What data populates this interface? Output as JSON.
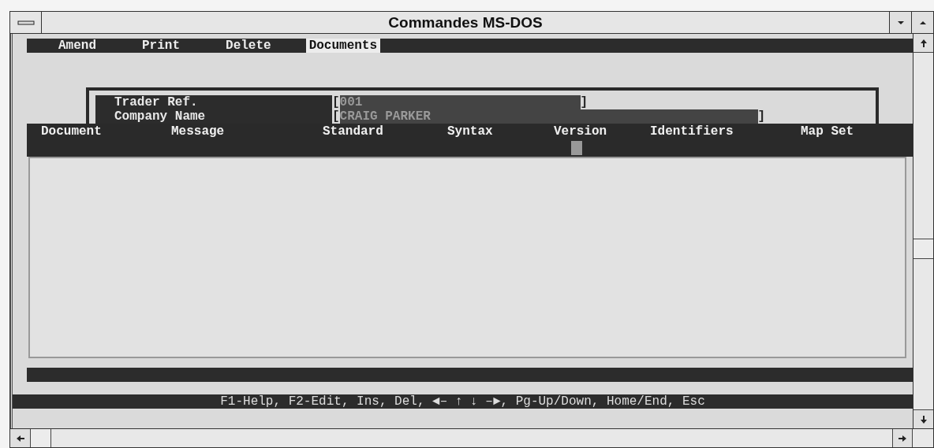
{
  "window": {
    "title": "Commandes MS-DOS"
  },
  "menu": [
    {
      "label": "Amend",
      "selected": false
    },
    {
      "label": "Print",
      "selected": false
    },
    {
      "label": "Delete",
      "selected": false
    },
    {
      "label": "Documents",
      "selected": true
    }
  ],
  "fields": [
    {
      "label": "Trader Ref.",
      "open": "[",
      "value": "001",
      "close": "]",
      "kind": "short"
    },
    {
      "label": "Company Name",
      "open": "[",
      "value": "CRAIG PARKER",
      "close": "]",
      "kind": "long"
    }
  ],
  "table": {
    "columns": [
      "Document",
      "Message",
      "Standard",
      "Syntax",
      "Version",
      "Identifiers",
      "Map Set"
    ]
  },
  "status_bar": "F1-Help, F2-Edit, Ins, Del, ◄– ↑ ↓ –►, Pg-Up/Down, Home/End, Esc"
}
